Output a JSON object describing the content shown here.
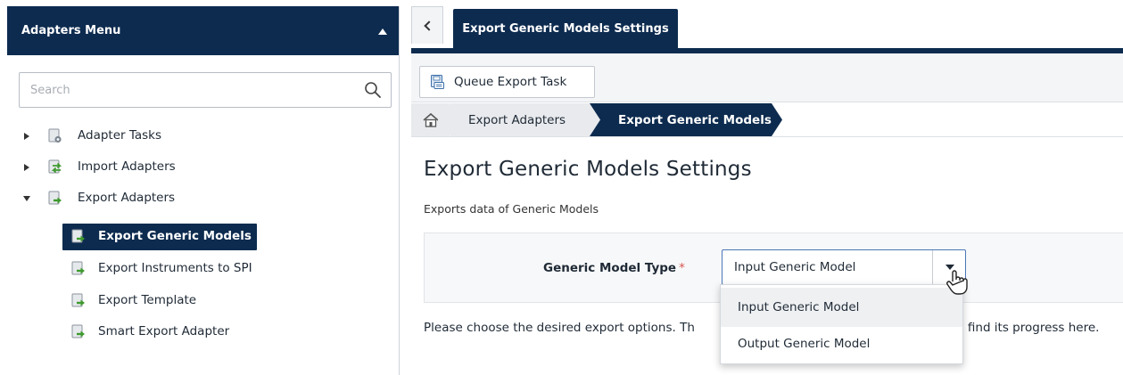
{
  "left_panel": {
    "title": "Adapters Menu",
    "search_placeholder": "Search",
    "tree": [
      {
        "label": "Adapter Tasks",
        "icon": "gear-document-icon",
        "expanded": false
      },
      {
        "label": "Import Adapters",
        "icon": "import-arrows-icon",
        "expanded": false
      },
      {
        "label": "Export Adapters",
        "icon": "export-arrow-icon",
        "expanded": true,
        "children": [
          {
            "label": "Export Generic Models",
            "selected": true
          },
          {
            "label": "Export Instruments to SPI"
          },
          {
            "label": "Export Template"
          },
          {
            "label": "Smart Export Adapter"
          }
        ]
      }
    ]
  },
  "tabs": {
    "active_label": "Export Generic Models Settings"
  },
  "toolbar": {
    "queue_label": "Queue Export Task"
  },
  "breadcrumb": {
    "items": [
      "Export Adapters",
      "Export Generic Models"
    ]
  },
  "main": {
    "title": "Export Generic Models Settings",
    "description": "Exports data of Generic Models",
    "field_label": "Generic Model Type",
    "required_mark": "*",
    "selected_value": "Input Generic Model",
    "options": [
      "Input Generic Model",
      "Output Generic Model"
    ],
    "info_left": "Please choose the desired export options. Th",
    "info_right": "find its progress here."
  },
  "colors": {
    "navy": "#0d2b4f",
    "required": "#d9534f",
    "select_border": "#4a78b6"
  }
}
